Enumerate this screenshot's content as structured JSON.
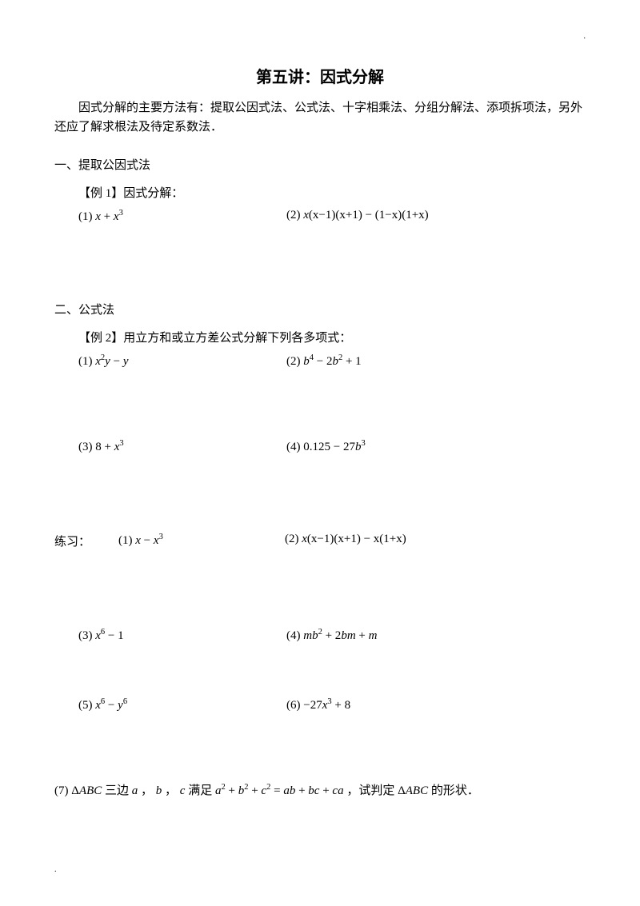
{
  "title": "第五讲：因式分解",
  "intro": "因式分解的主要方法有：提取公因式法、公式法、十字相乘法、分组分解法、添项拆项法，另外还应了解求根法及待定系数法．",
  "section1": {
    "head": "一、提取公因式法",
    "example_label": "【例 1】因式分解：",
    "q1_label": "(1) ",
    "q2_label": "(2) "
  },
  "section2": {
    "head": "二、公式法",
    "example_label": "【例 2】用立方和或立方差公式分解下列各多项式：",
    "q1_label": "(1) ",
    "q2_label": "(2) ",
    "q3_label": "(3) ",
    "q4_label": "(4) "
  },
  "practice": {
    "prefix": "练习：",
    "q1_label": "(1) ",
    "q2_label": "(2) ",
    "q3_label": "(3) ",
    "q4_label": "(4) ",
    "q5_label": "(5) ",
    "q6_label": "(6) ",
    "q7_label": "(7) ",
    "q7_text1": "三边",
    "q7_text2": "，",
    "q7_text3": "，",
    "q7_text4": "满足",
    "q7_text5": "，试判定",
    "q7_text6": "的形状．"
  },
  "dot": "."
}
